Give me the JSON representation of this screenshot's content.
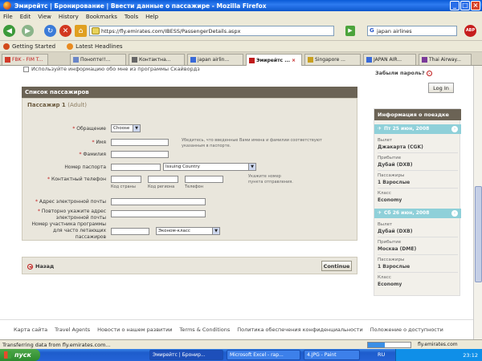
{
  "window": {
    "title": "Эмирейтс | Бронирование | Ввести данные о пассажире - Mozilla Firefox"
  },
  "menu": [
    "File",
    "Edit",
    "View",
    "History",
    "Bookmarks",
    "Tools",
    "Help"
  ],
  "nav": {
    "url": "https://fly.emirates.com/IBESS/PassengerDetails.aspx",
    "search_value": "japan airlines"
  },
  "bookmarks": [
    "Getting Started",
    "Latest Headlines"
  ],
  "tabs": [
    "FBK - FIM T...",
    "Понопте!!...",
    "Контактна...",
    "japan airlin...",
    "Эмирейтс ...",
    "Singapore ...",
    "JAPAN AIR...",
    "Thai Airway..."
  ],
  "form": {
    "skywards_text": "Используйте информацию обо мне из программы Скайвордз",
    "section_title": "Список пассажиров",
    "passenger_title": "Пассажир 1",
    "passenger_type": "(Adult)",
    "title_label": "Обращение",
    "title_value": "Choose",
    "name_label": "Имя",
    "surname_label": "Фамилия",
    "name_note": "Убедитесь, что введенные Вами имена и фамилии соответствуют указанным в паспорте.",
    "passport_label": "Номер паспорта",
    "passport_country_value": "Issuing Country",
    "phone_label": "Контактный телефон",
    "phone_note": "Укажите номер пункта отправления.",
    "phone_sub_country": "Код страны",
    "phone_sub_region": "Код региона",
    "phone_sub_number": "Телефон",
    "email_label": "Адрес электронной почты",
    "email_confirm_label": "Повторно укажите адрес электронной почты",
    "ffp_label": "Номер участника программы для часто летающих пассажиров",
    "ffp_class_value": "Эконом-класс",
    "back_label": "Назад",
    "continue_label": "Continue"
  },
  "sidebar": {
    "forgot_password": "Забыли пароль?",
    "login_label": "Log In",
    "trip_title": "Информация о поездке",
    "segments": [
      {
        "date": "Пт 25 июн, 2008",
        "dep_label": "Вылет",
        "dep_value": "Джакарта (CGK)",
        "arr_label": "Прибытие",
        "arr_value": "Дубай (DXB)",
        "pax_label": "Пассажиры",
        "pax_value": "1 Взрослые",
        "class_label": "Класс",
        "class_value": "Economy"
      },
      {
        "date": "Сб 26 июн, 2008",
        "dep_label": "Вылет",
        "dep_value": "Дубай (DXB)",
        "arr_label": "Прибытие",
        "arr_value": "Москва (DME)",
        "pax_label": "Пассажиры",
        "pax_value": "1 Взрослые",
        "class_label": "Класс",
        "class_value": "Economy"
      }
    ]
  },
  "footer_links": [
    "Карта сайта",
    "Travel Agents",
    "Новости о нашем развитии",
    "Terms & Conditions",
    "Политика обеспечения конфиденциальности",
    "Положение о доступности"
  ],
  "status": {
    "text": "Transferring data from fly.emirates.com...",
    "host": "fly.emirates.com",
    "progress": 0.4
  },
  "taskbar": {
    "start_label": "пуск",
    "tasks": [
      "Эмирейтс | Бронир...",
      "Microsoft Excel - rap...",
      "4.JPG - Paint"
    ],
    "lang": "RU",
    "clock": "23:12"
  }
}
